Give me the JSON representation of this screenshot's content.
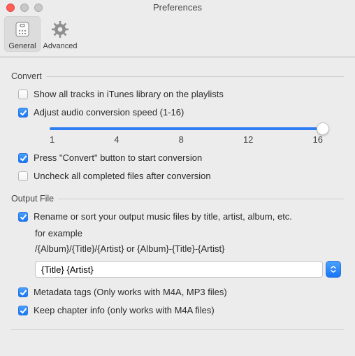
{
  "window": {
    "title": "Preferences"
  },
  "toolbar": {
    "items": [
      {
        "label": "General"
      },
      {
        "label": "Advanced"
      }
    ]
  },
  "convert": {
    "header": "Convert",
    "showAllTracks": {
      "label": "Show all tracks in iTunes library on the playlists",
      "checked": false
    },
    "adjustSpeed": {
      "label": "Adjust audio conversion speed (1-16)",
      "checked": true,
      "slider": {
        "min": 1,
        "max": 16,
        "value": 16,
        "ticks": [
          "1",
          "4",
          "8",
          "12",
          "16"
        ]
      }
    },
    "pressConvert": {
      "label": "Press \"Convert\" button to start conversion",
      "checked": true
    },
    "uncheckAfter": {
      "label": "Uncheck all completed files after conversion",
      "checked": false
    }
  },
  "output": {
    "header": "Output File",
    "rename": {
      "label": "Rename or sort your output music files by title, artist, album, etc.",
      "checked": true
    },
    "example": {
      "line1": "for example",
      "line2": "/{Album}/{Title}/{Artist} or {Album}-{Title}-{Artist}"
    },
    "patternValue": "{Title} {Artist}",
    "metadata": {
      "label": "Metadata tags (Only works with M4A, MP3 files)",
      "checked": true
    },
    "chapter": {
      "label": "Keep chapter info (only works with  M4A files)",
      "checked": true
    }
  }
}
